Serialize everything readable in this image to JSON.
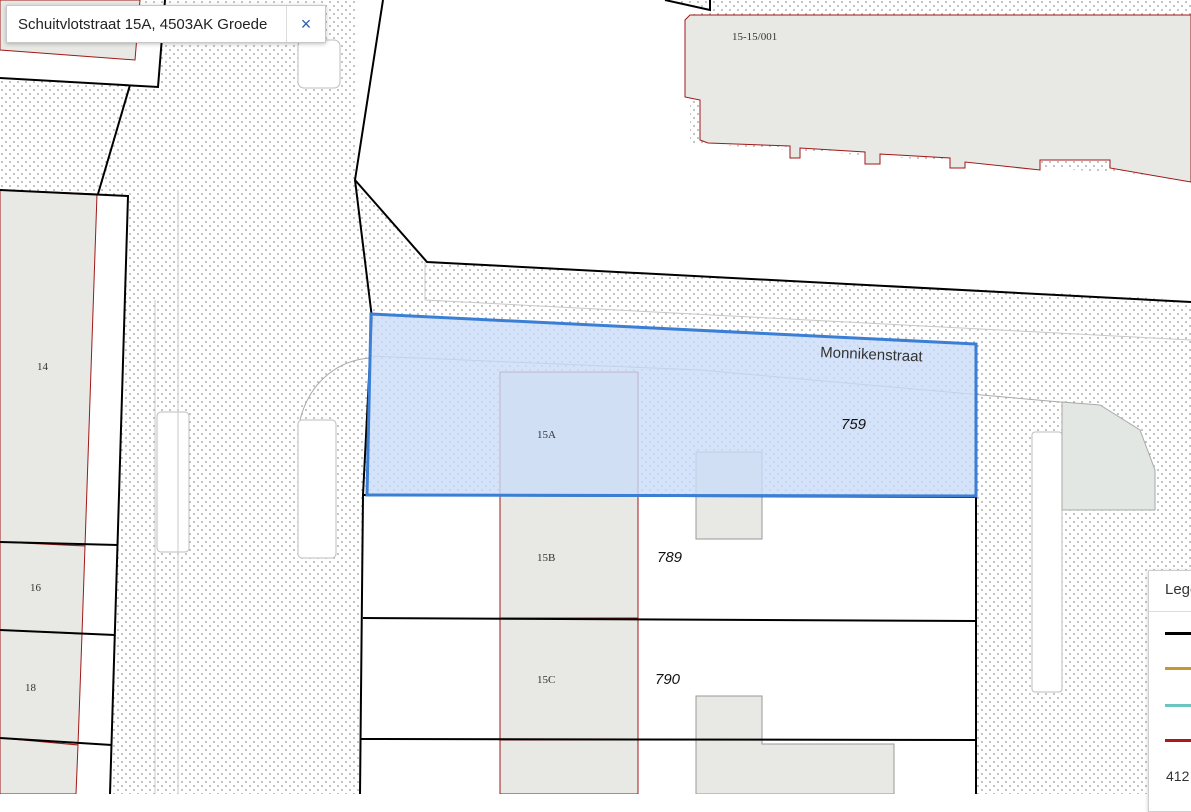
{
  "search": {
    "query": "Schuitvlotstraat 15A, 4503AK Groede",
    "clear_label": "×"
  },
  "labels": {
    "street": "Monnikenstraat",
    "house_14": "14",
    "house_16": "16",
    "house_18": "18",
    "house_15a": "15A",
    "house_15b": "15B",
    "house_15c": "15C",
    "building_top": "15-15/001",
    "parcel_759": "759",
    "parcel_789": "789",
    "parcel_790": "790"
  },
  "legend": {
    "title": "Legenda",
    "lines": [
      {
        "name": "legend-line-black",
        "color": "#000000"
      },
      {
        "name": "legend-line-orange",
        "color": "#c8962e"
      },
      {
        "name": "legend-line-teal",
        "color": "#6cc6c0"
      },
      {
        "name": "legend-line-red",
        "color": "#b01818"
      }
    ],
    "value": "412"
  },
  "colors": {
    "selection_fill": "#c9dcf7",
    "selection_stroke": "#3a7fd5",
    "building_fill": "#e8e8e4",
    "building_stroke": "#a01818",
    "parcel_stroke": "#000000",
    "dot": "#9a9a9a"
  }
}
